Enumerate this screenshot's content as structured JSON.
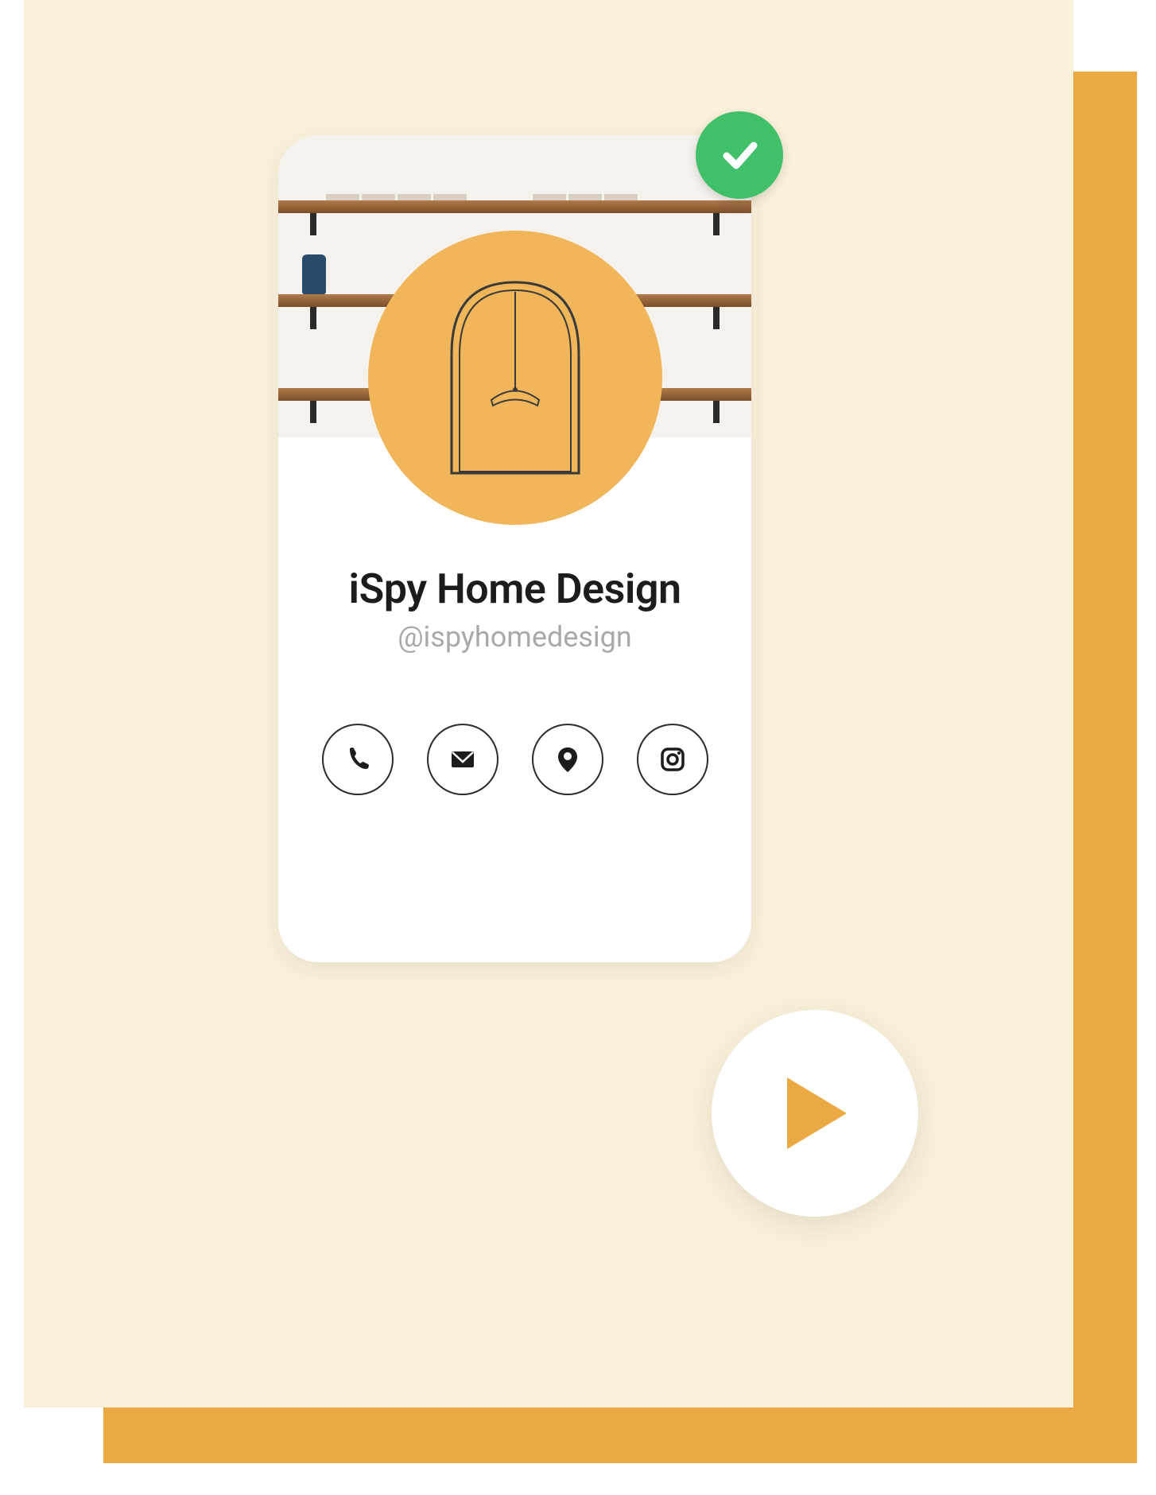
{
  "profile": {
    "name": "iSpy Home Design",
    "handle": "@ispyhomedesign",
    "verified": true
  },
  "actions": [
    {
      "id": "phone",
      "icon": "phone-icon"
    },
    {
      "id": "email",
      "icon": "mail-icon"
    },
    {
      "id": "location",
      "icon": "location-pin-icon"
    },
    {
      "id": "instagram",
      "icon": "instagram-icon"
    }
  ],
  "colors": {
    "accent": "#eaa943",
    "cream": "#fbf1db",
    "avatar_bg": "#f1b65a",
    "verify_green": "#41c06a",
    "play_triangle": "#eaa943"
  }
}
